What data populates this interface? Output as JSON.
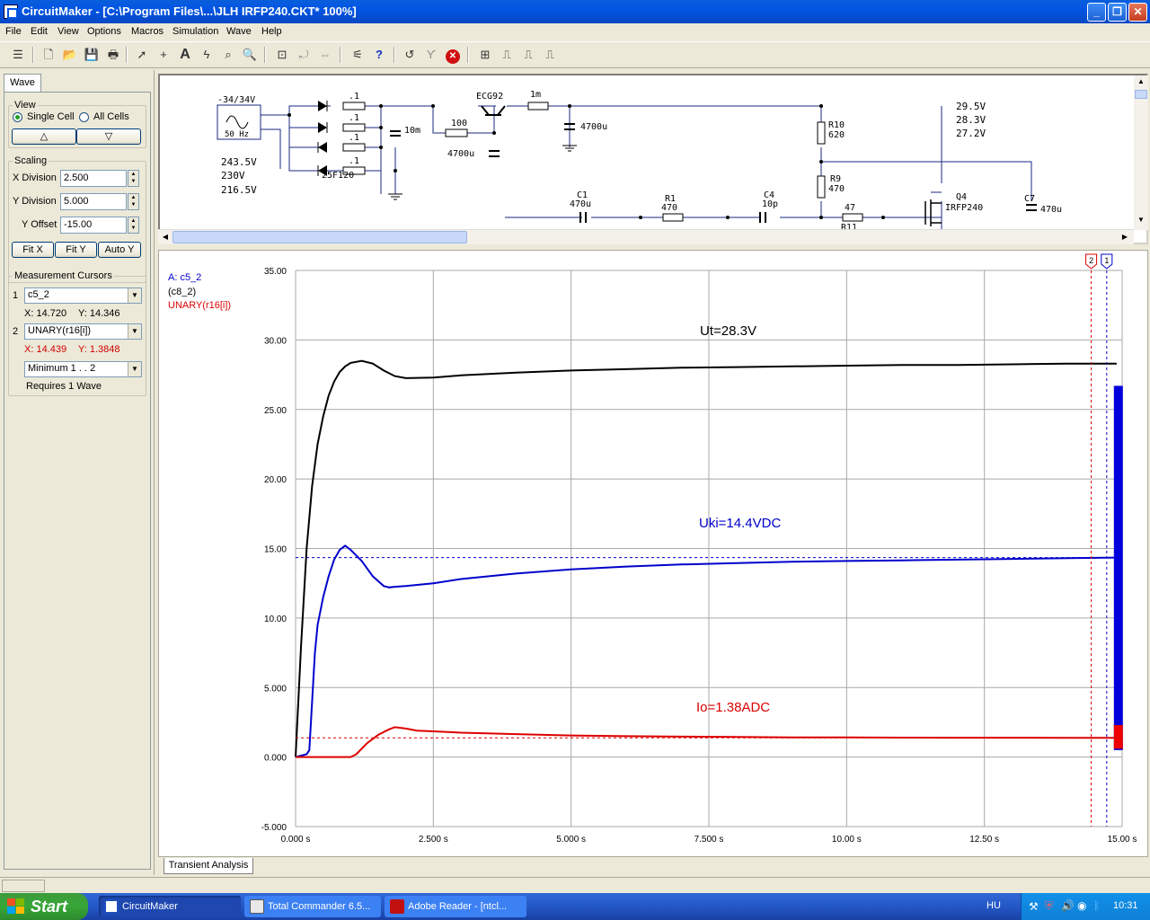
{
  "window": {
    "title": "CircuitMaker - [C:\\Program Files\\...\\JLH IRFP240.CKT* 100%]"
  },
  "menu": [
    "File",
    "Edit",
    "View",
    "Options",
    "Macros",
    "Simulation",
    "Wave",
    "Help"
  ],
  "left_panel": {
    "tab": "Wave",
    "view": {
      "legend": "View",
      "single": "Single Cell",
      "all": "All Cells",
      "up": "△",
      "down": "▽"
    },
    "scaling": {
      "legend": "Scaling",
      "xdiv_label": "X Division",
      "xdiv": "2.500",
      "ydiv_label": "Y Division",
      "ydiv": "5.000",
      "yoff_label": "Y Offset",
      "yoff": "-15.00",
      "fitx": "Fit X",
      "fity": "Fit Y",
      "autoy": "Auto Y"
    },
    "cursors": {
      "legend": "Measurement Cursors",
      "c1_num": "1",
      "c1_sel": "c5_2",
      "c1_x": "X: 14.720",
      "c1_y": "Y: 14.346",
      "c2_num": "2",
      "c2_sel": "UNARY(r16[i])",
      "c2_x": "X: 14.439",
      "c2_y": "Y: 1.3848",
      "measure": "Minimum  1 . . 2",
      "requires": "Requires 1 Wave"
    }
  },
  "schematic": {
    "source_top": "-34/34V",
    "source_freq": "50 Hz",
    "v1": "243.5V",
    "v2": "230V",
    "v3": "216.5V",
    "diode": "25F120",
    "r_small": ".1",
    "c10m": "10m",
    "r100": "100",
    "c4700a": "4700u",
    "c4700b": "4700u",
    "trans": "ECG92",
    "l1m": "1m",
    "r10": "R10",
    "r10v": "620",
    "r9": "R9",
    "r9v": "470",
    "out1": "29.5V",
    "out2": "28.3V",
    "out3": "27.2V",
    "c1": "C1",
    "c1v": "470u",
    "r1": "R1",
    "r1v": "470",
    "c4": "C4",
    "c4v": "10p",
    "r11v": "47",
    "r11": "R11",
    "q4": "Q4",
    "q4v": "IRFP240",
    "c7": "C7",
    "c7v": "470u"
  },
  "wave": {
    "tab": "Transient Analysis",
    "legend_a": "A: c5_2",
    "legend_b": "(c8_2)",
    "legend_c": "UNARY(r16[i])",
    "ann_ut": "Ut=28.3V",
    "ann_uki": "Uki=14.4VDC",
    "ann_io": "Io=1.38ADC",
    "cursor1_label": "1",
    "cursor2_label": "2"
  },
  "chart_data": {
    "type": "line",
    "xlabel": "",
    "ylabel": "",
    "xlim": [
      0,
      15
    ],
    "ylim": [
      -5,
      35
    ],
    "x_ticks": [
      "0.000 s",
      "2.500 s",
      "5.000 s",
      "7.500 s",
      "10.00 s",
      "12.50 s",
      "15.00 s"
    ],
    "y_ticks": [
      "35.00",
      "30.00",
      "25.00",
      "20.00",
      "15.00",
      "10.00",
      "5.000",
      "0.000",
      "-5.000"
    ],
    "cursors": {
      "cursor1_x": 14.72,
      "cursor1_y": 14.346,
      "cursor2_x": 14.439,
      "cursor2_y": 1.3848
    },
    "series": [
      {
        "name": "(c8_2)",
        "color": "#000000",
        "x": [
          0,
          0.1,
          0.2,
          0.3,
          0.4,
          0.5,
          0.6,
          0.7,
          0.8,
          0.9,
          1.0,
          1.2,
          1.4,
          1.6,
          1.8,
          2.0,
          2.5,
          3,
          4,
          5,
          6,
          7,
          8,
          9,
          10,
          11,
          12,
          13,
          14,
          14.9
        ],
        "y": [
          0,
          8,
          15,
          19.5,
          22.5,
          24.5,
          26,
          27,
          27.7,
          28.1,
          28.35,
          28.5,
          28.3,
          27.8,
          27.4,
          27.25,
          27.3,
          27.45,
          27.65,
          27.8,
          27.9,
          28.0,
          28.05,
          28.1,
          28.15,
          28.2,
          28.2,
          28.25,
          28.3,
          28.3
        ]
      },
      {
        "name": "A: c5_2",
        "color": "#0000cc",
        "x": [
          0,
          0.2,
          0.25,
          0.3,
          0.35,
          0.4,
          0.5,
          0.6,
          0.7,
          0.8,
          0.9,
          1.0,
          1.1,
          1.2,
          1.4,
          1.6,
          1.7,
          1.8,
          2.0,
          2.5,
          3,
          4,
          5,
          6,
          7,
          8,
          9,
          10,
          11,
          12,
          13,
          14,
          14.9
        ],
        "y": [
          0,
          0.2,
          0.5,
          4.0,
          7.5,
          9.5,
          11.5,
          13.0,
          14.2,
          14.9,
          15.2,
          14.9,
          14.5,
          14.1,
          13.0,
          12.3,
          12.2,
          12.25,
          12.3,
          12.5,
          12.8,
          13.2,
          13.5,
          13.7,
          13.85,
          13.95,
          14.05,
          14.1,
          14.15,
          14.2,
          14.25,
          14.3,
          14.35
        ]
      },
      {
        "name": "UNARY(r16[i])",
        "color": "#dd0000",
        "x": [
          0,
          0.5,
          1.0,
          1.1,
          1.3,
          1.5,
          1.7,
          1.8,
          2.0,
          2.2,
          2.5,
          3,
          4,
          5,
          6,
          7,
          8,
          9,
          10,
          11,
          12,
          13,
          14,
          14.9
        ],
        "y": [
          0,
          0,
          0,
          0.2,
          1.0,
          1.6,
          2.0,
          2.15,
          2.05,
          1.9,
          1.85,
          1.75,
          1.65,
          1.55,
          1.5,
          1.47,
          1.44,
          1.42,
          1.41,
          1.4,
          1.39,
          1.39,
          1.38,
          1.38
        ]
      }
    ]
  },
  "taskbar": {
    "start": "Start",
    "tasks": [
      "CircuitMaker",
      "Total Commander 6.5...",
      "Adobe Reader - [ntcl..."
    ],
    "lang": "HU",
    "clock": "10:31"
  }
}
